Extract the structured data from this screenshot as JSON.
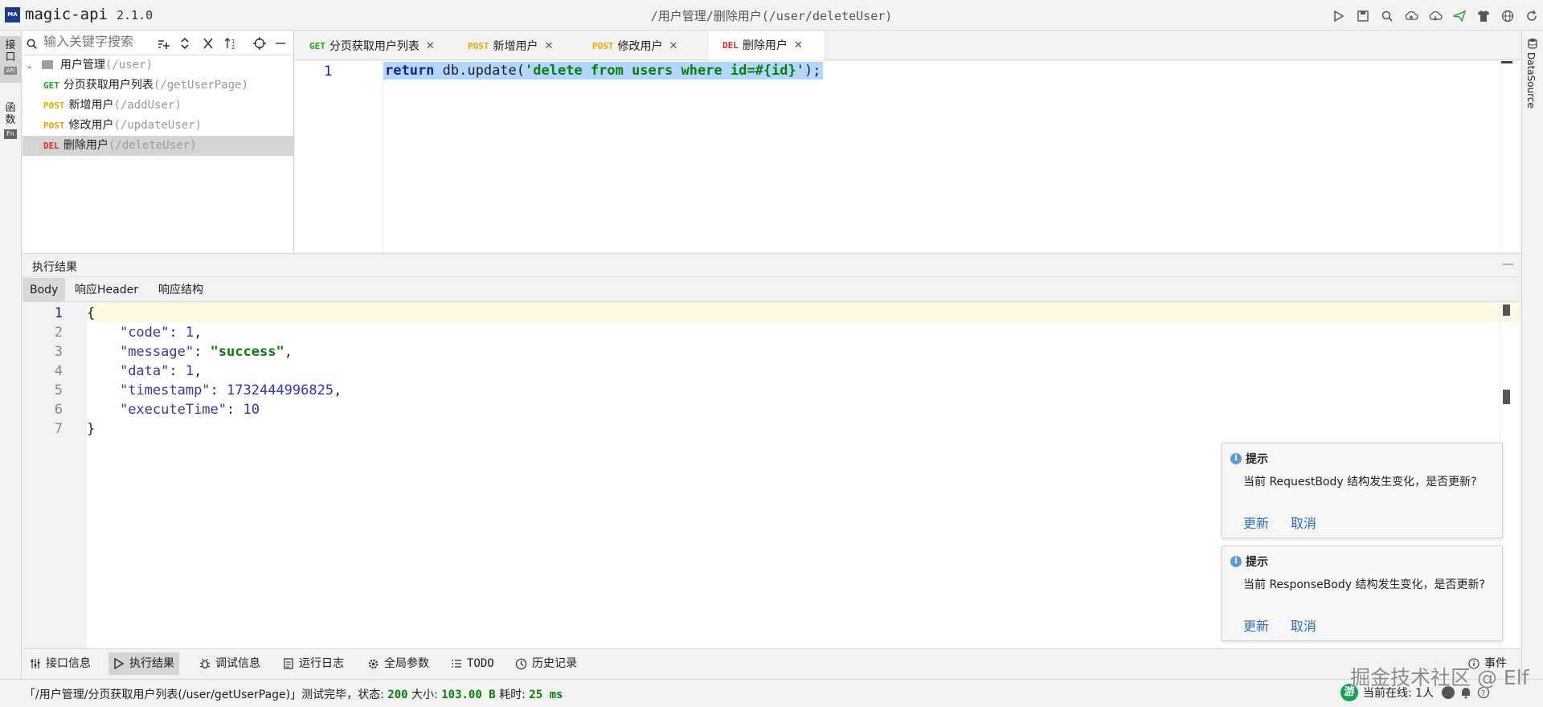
{
  "app": {
    "name": "magic-api",
    "version": "2.1.0",
    "logo": "MA",
    "title_path": "/用户管理/删除用户(/user/deleteUser)"
  },
  "titlebar_icons": [
    "run-icon",
    "save-icon",
    "search-icon",
    "upload-icon",
    "download-icon",
    "push-icon",
    "skin-icon",
    "language-icon",
    "refresh-icon"
  ],
  "left_strip": {
    "tabs": [
      {
        "label": "接口"
      },
      {
        "label": "函数"
      }
    ],
    "api_badge": "API",
    "fn_badge": "Fn"
  },
  "right_strip": {
    "tab": "DataSource"
  },
  "tree": {
    "search_placeholder": "输入关键字搜索",
    "group": {
      "name": "用户管理",
      "path": "(/user)"
    },
    "items": [
      {
        "method": "GET",
        "name": "分页获取用户列表",
        "path": "(/getUserPage)",
        "selected": false
      },
      {
        "method": "POST",
        "name": "新增用户",
        "path": "(/addUser)",
        "selected": false
      },
      {
        "method": "POST",
        "name": "修改用户",
        "path": "(/updateUser)",
        "selected": false
      },
      {
        "method": "DEL",
        "name": "删除用户",
        "path": "(/deleteUser)",
        "selected": true
      }
    ]
  },
  "tabs": [
    {
      "method": "GET",
      "name": "分页获取用户列表",
      "active": false
    },
    {
      "method": "POST",
      "name": "新增用户",
      "active": false
    },
    {
      "method": "POST",
      "name": "修改用户",
      "active": false
    },
    {
      "method": "DEL",
      "name": "删除用户",
      "active": true
    }
  ],
  "editor": {
    "line": "1",
    "code_kw": "return",
    "code_rest": " db.update(",
    "code_str": "'delete from users where id=#{id}'",
    "code_end": ");"
  },
  "result": {
    "title": "执行结果",
    "minimize": "—",
    "tabs": [
      "Body",
      "响应Header",
      "响应结构"
    ],
    "lines": [
      "1",
      "2",
      "3",
      "4",
      "5",
      "6",
      "7"
    ],
    "json": {
      "open": "{",
      "close": "}",
      "code_key": "\"code\"",
      "code_val": "1",
      "message_key": "\"message\"",
      "message_val": "\"success\"",
      "data_key": "\"data\"",
      "data_val": "1",
      "ts_key": "\"timestamp\"",
      "ts_val": "1732444996825",
      "exec_key": "\"executeTime\"",
      "exec_val": "10"
    }
  },
  "notifications": [
    {
      "title": "提示",
      "body": "当前 RequestBody 结构发生变化，是否更新?",
      "update": "更新",
      "cancel": "取消"
    },
    {
      "title": "提示",
      "body": "当前 ResponseBody 结构发生变化，是否更新?",
      "update": "更新",
      "cancel": "取消"
    }
  ],
  "bottom_tabs": [
    {
      "label": "接口信息",
      "icon": "sliders-icon",
      "active": false
    },
    {
      "label": "执行结果",
      "icon": "play-icon",
      "active": true
    },
    {
      "label": "调试信息",
      "icon": "bug-icon",
      "active": false
    },
    {
      "label": "运行日志",
      "icon": "log-icon",
      "active": false
    },
    {
      "label": "全局参数",
      "icon": "gear-icon",
      "active": false
    },
    {
      "label": "TODO",
      "icon": "list-icon",
      "active": false
    },
    {
      "label": "历史记录",
      "icon": "clock-icon",
      "active": false
    }
  ],
  "event_label": "事件",
  "status": {
    "prefix": "「/用户管理/分页获取用户列表(/user/getUserPage)」测试完毕，状态: ",
    "status_code": "200",
    "size_label": " 大小: ",
    "size": "103.00 B",
    "time_label": " 耗时: ",
    "time": "25 ms"
  },
  "online": {
    "avatar": "游",
    "text": "当前在线: 1人"
  },
  "watermark": "掘金技术社区 @ Elf",
  "colors": {
    "get": "#21a321",
    "post": "#f0a800",
    "del": "#dd2a2a",
    "link": "#2a6ebb",
    "selection": "#b3d7ff"
  }
}
